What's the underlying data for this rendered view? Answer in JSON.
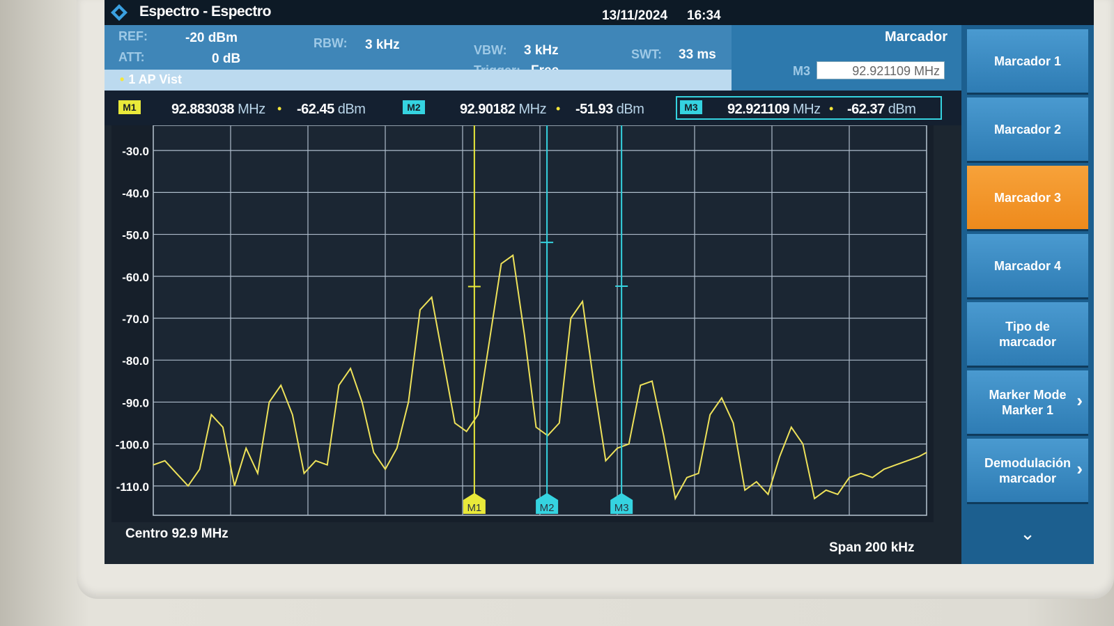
{
  "title_bar": {
    "app_title": "Espectro - Espectro",
    "date": "13/11/2024",
    "time": "16:34"
  },
  "params": {
    "ref_label": "REF:",
    "ref_value": "-20 dBm",
    "att_label": "ATT:",
    "att_value": "0 dB",
    "rbw_label": "RBW:",
    "rbw_value": "3 kHz",
    "vbw_label": "VBW:",
    "vbw_value": "3 kHz",
    "trigger_label": "Trigger:",
    "trigger_value": "Free",
    "swt_label": "SWT:",
    "swt_value": "33 ms",
    "trace_label": "1 AP Vist"
  },
  "marker_panel": {
    "title": "Marcador",
    "active_label": "M3",
    "active_value": "92.921109 MHz"
  },
  "markers": [
    {
      "tag": "M1",
      "freq": "92.883038",
      "freq_unit": "MHz",
      "level": "-62.45",
      "level_unit": "dBm",
      "color": "#e9e93a"
    },
    {
      "tag": "M2",
      "freq": "92.90182",
      "freq_unit": "MHz",
      "level": "-51.93",
      "level_unit": "dBm",
      "color": "#35d3e0"
    },
    {
      "tag": "M3",
      "freq": "92.921109",
      "freq_unit": "MHz",
      "level": "-62.37",
      "level_unit": "dBm",
      "color": "#35d3e0"
    }
  ],
  "chart_data": {
    "type": "line",
    "xlim": [
      92.8,
      93.0
    ],
    "ylim": [
      -117,
      -24
    ],
    "y_ticks": [
      "-30.0",
      "-40.0",
      "-50.0",
      "-60.0",
      "-70.0",
      "-80.0",
      "-90.0",
      "-100.0",
      "-110.0"
    ],
    "grid": true,
    "series": [
      {
        "x": [
          92.8,
          92.803,
          92.806,
          92.809,
          92.812,
          92.815,
          92.818,
          92.821,
          92.824,
          92.827,
          92.83,
          92.833,
          92.836,
          92.839,
          92.842,
          92.845,
          92.848,
          92.851,
          92.854,
          92.857,
          92.86,
          92.863,
          92.866,
          92.869,
          92.872,
          92.875,
          92.878,
          92.881,
          92.884,
          92.887,
          92.89,
          92.893,
          92.896,
          92.899,
          92.902,
          92.905,
          92.908,
          92.911,
          92.914,
          92.917,
          92.92,
          92.923,
          92.926,
          92.929,
          92.932,
          92.935,
          92.938,
          92.941,
          92.944,
          92.947,
          92.95,
          92.953,
          92.956,
          92.959,
          92.962,
          92.965,
          92.968,
          92.971,
          92.974,
          92.977,
          92.98,
          92.983,
          92.986,
          92.989,
          92.992,
          92.995,
          92.998,
          93.0
        ],
        "y": [
          -105,
          -104,
          -107,
          -110,
          -106,
          -93,
          -96,
          -110,
          -101,
          -107,
          -90,
          -86,
          -93,
          -107,
          -104,
          -105,
          -86,
          -82,
          -90,
          -102,
          -106,
          -101,
          -90,
          -68,
          -65,
          -80,
          -95,
          -97,
          -93,
          -75,
          -57,
          -55,
          -74,
          -96,
          -98,
          -95,
          -70,
          -66,
          -86,
          -104,
          -101,
          -100,
          -86,
          -85,
          -98,
          -113,
          -108,
          -107,
          -93,
          -89,
          -95,
          -111,
          -109,
          -112,
          -103,
          -96,
          -100,
          -113,
          -111,
          -112,
          -108,
          -107,
          -108,
          -106,
          -105,
          -104,
          -103,
          -102
        ]
      }
    ]
  },
  "footer": {
    "center": "Centro 92.9 MHz",
    "span": "Span 200 kHz"
  },
  "softkeys": [
    {
      "label": "Marcador 1",
      "line2": ""
    },
    {
      "label": "Marcador 2",
      "line2": ""
    },
    {
      "label": "Marcador 3",
      "line2": ""
    },
    {
      "label": "Marcador 4",
      "line2": ""
    },
    {
      "label": "Tipo de",
      "line2": "marcador"
    },
    {
      "label": "Marker Mode",
      "line2": "Marker 1"
    },
    {
      "label": "Demodulación",
      "line2": "marcador"
    }
  ],
  "softkey_more": "⌄"
}
